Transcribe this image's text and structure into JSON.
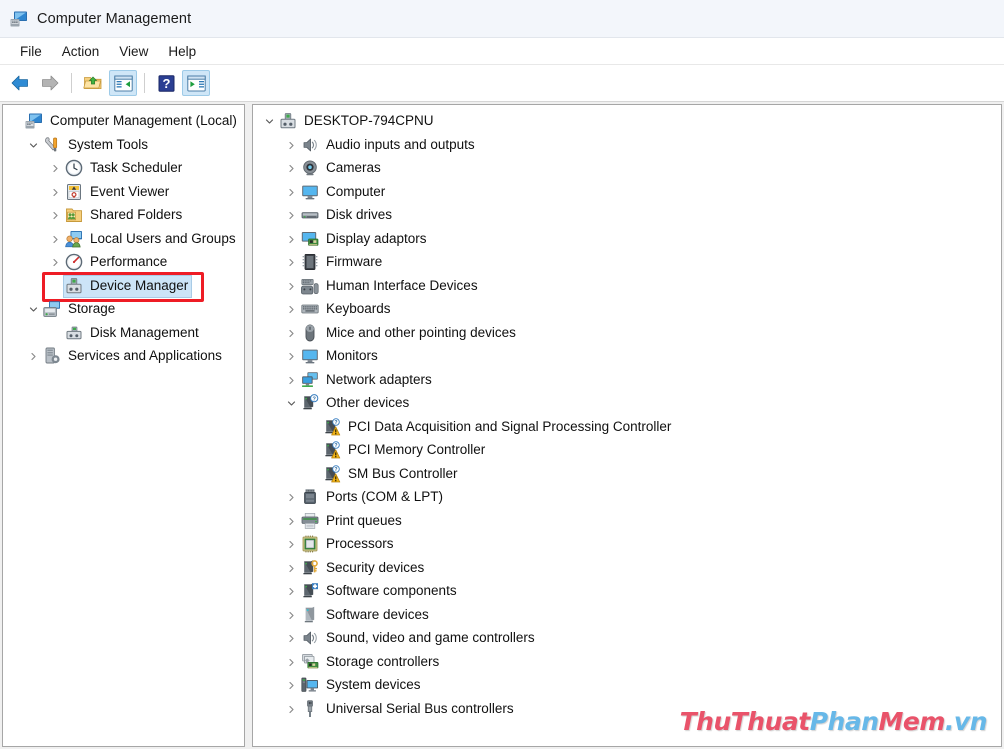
{
  "window": {
    "title": "Computer Management",
    "app_icon": "computer-management-icon"
  },
  "menubar": {
    "items": [
      {
        "label": "File"
      },
      {
        "label": "Action"
      },
      {
        "label": "View"
      },
      {
        "label": "Help"
      }
    ]
  },
  "toolbar": {
    "buttons": [
      {
        "name": "back-button",
        "icon": "back-arrow-icon",
        "active": false
      },
      {
        "name": "forward-button",
        "icon": "forward-arrow-icon",
        "active": false
      },
      {
        "name": "up-one-level-button",
        "icon": "folder-up-icon",
        "active": false
      },
      {
        "name": "show-hide-console-tree-button",
        "icon": "console-tree-icon",
        "active": true
      },
      {
        "name": "help-button",
        "icon": "question-mark-icon",
        "active": false
      },
      {
        "name": "show-hide-action-pane-button",
        "icon": "action-pane-icon",
        "active": true
      }
    ]
  },
  "console_tree": {
    "items": [
      {
        "label": "Computer Management (Local)",
        "icon": "computer-management-icon",
        "indent": 0,
        "state": "none",
        "selected": false
      },
      {
        "label": "System Tools",
        "icon": "system-tools-icon",
        "indent": 1,
        "state": "expanded",
        "selected": false
      },
      {
        "label": "Task Scheduler",
        "icon": "clock-icon",
        "indent": 2,
        "state": "collapsed",
        "selected": false
      },
      {
        "label": "Event Viewer",
        "icon": "event-viewer-icon",
        "indent": 2,
        "state": "collapsed",
        "selected": false
      },
      {
        "label": "Shared Folders",
        "icon": "shared-folders-icon",
        "indent": 2,
        "state": "collapsed",
        "selected": false
      },
      {
        "label": "Local Users and Groups",
        "icon": "users-groups-icon",
        "indent": 2,
        "state": "collapsed",
        "selected": false
      },
      {
        "label": "Performance",
        "icon": "performance-icon",
        "indent": 2,
        "state": "collapsed",
        "selected": false
      },
      {
        "label": "Device Manager",
        "icon": "device-manager-icon",
        "indent": 2,
        "state": "none",
        "selected": true
      },
      {
        "label": "Storage",
        "icon": "storage-icon",
        "indent": 1,
        "state": "expanded",
        "selected": false
      },
      {
        "label": "Disk Management",
        "icon": "disk-management-icon",
        "indent": 2,
        "state": "none",
        "selected": false
      },
      {
        "label": "Services and Applications",
        "icon": "services-applications-icon",
        "indent": 1,
        "state": "collapsed",
        "selected": false
      }
    ]
  },
  "device_tree": {
    "items": [
      {
        "label": "DESKTOP-794CPNU",
        "icon": "computer-root-icon",
        "indent": 0,
        "state": "expanded"
      },
      {
        "label": "Audio inputs and outputs",
        "icon": "speaker-icon",
        "indent": 1,
        "state": "collapsed"
      },
      {
        "label": "Cameras",
        "icon": "camera-icon",
        "indent": 1,
        "state": "collapsed"
      },
      {
        "label": "Computer",
        "icon": "monitor-icon",
        "indent": 1,
        "state": "collapsed"
      },
      {
        "label": "Disk drives",
        "icon": "disk-drive-icon",
        "indent": 1,
        "state": "collapsed"
      },
      {
        "label": "Display adaptors",
        "icon": "display-adapter-icon",
        "indent": 1,
        "state": "collapsed"
      },
      {
        "label": "Firmware",
        "icon": "firmware-chip-icon",
        "indent": 1,
        "state": "collapsed"
      },
      {
        "label": "Human Interface Devices",
        "icon": "hid-icon",
        "indent": 1,
        "state": "collapsed"
      },
      {
        "label": "Keyboards",
        "icon": "keyboard-icon",
        "indent": 1,
        "state": "collapsed"
      },
      {
        "label": "Mice and other pointing devices",
        "icon": "mouse-icon",
        "indent": 1,
        "state": "collapsed"
      },
      {
        "label": "Monitors",
        "icon": "monitor-icon",
        "indent": 1,
        "state": "collapsed"
      },
      {
        "label": "Network adapters",
        "icon": "network-adapter-icon",
        "indent": 1,
        "state": "collapsed"
      },
      {
        "label": "Other devices",
        "icon": "unknown-device-icon",
        "indent": 1,
        "state": "expanded"
      },
      {
        "label": "PCI Data Acquisition and Signal Processing Controller",
        "icon": "unknown-device-warning-icon",
        "indent": 2,
        "state": "none"
      },
      {
        "label": "PCI Memory Controller",
        "icon": "unknown-device-warning-icon",
        "indent": 2,
        "state": "none"
      },
      {
        "label": "SM Bus Controller",
        "icon": "unknown-device-warning-icon",
        "indent": 2,
        "state": "none"
      },
      {
        "label": "Ports (COM & LPT)",
        "icon": "port-icon",
        "indent": 1,
        "state": "collapsed"
      },
      {
        "label": "Print queues",
        "icon": "printer-icon",
        "indent": 1,
        "state": "collapsed"
      },
      {
        "label": "Processors",
        "icon": "processor-icon",
        "indent": 1,
        "state": "collapsed"
      },
      {
        "label": "Security devices",
        "icon": "security-key-icon",
        "indent": 1,
        "state": "collapsed"
      },
      {
        "label": "Software components",
        "icon": "software-component-icon",
        "indent": 1,
        "state": "collapsed"
      },
      {
        "label": "Software devices",
        "icon": "software-device-icon",
        "indent": 1,
        "state": "collapsed"
      },
      {
        "label": "Sound, video and game controllers",
        "icon": "speaker-icon",
        "indent": 1,
        "state": "collapsed"
      },
      {
        "label": "Storage controllers",
        "icon": "storage-controller-icon",
        "indent": 1,
        "state": "collapsed"
      },
      {
        "label": "System devices",
        "icon": "system-device-icon",
        "indent": 1,
        "state": "collapsed"
      },
      {
        "label": "Universal Serial Bus controllers",
        "icon": "usb-icon",
        "indent": 1,
        "state": "collapsed"
      }
    ]
  },
  "watermark": {
    "part1": "ThuThuat",
    "part2": "Phan",
    "part3": "Mem",
    "part4": ".vn",
    "color1": "#e9536a",
    "color2": "#67b8e8"
  },
  "colors": {
    "selection": "#cce4f7",
    "highlight_box": "#ee1c25",
    "titlebar_bg": "#f3f6fb",
    "pane_border": "#a6a6a6"
  }
}
